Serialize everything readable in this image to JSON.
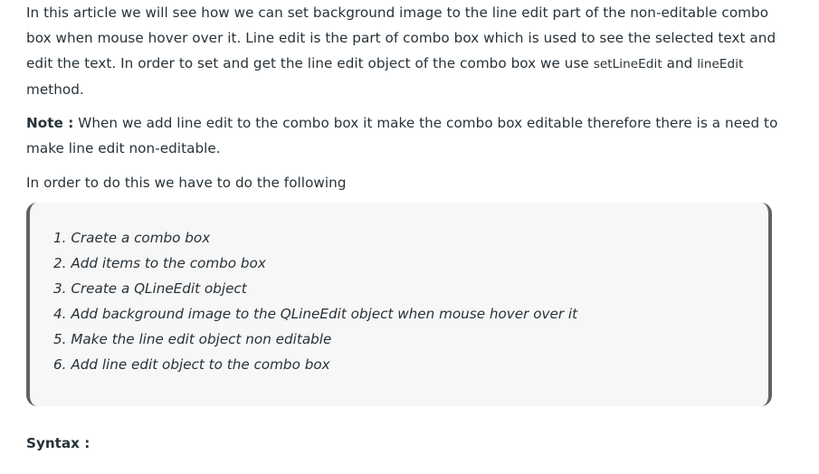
{
  "article": {
    "intro": {
      "text_before_code": "In this article we will see how we can set background image to the line edit part of the non-editable combo box when mouse hover over it. Line edit is the part of combo box which is used to see the selected text and edit the text. In order to set and get the line edit object of the combo box we use ",
      "code1": "setLineEdit",
      "and_text": " and ",
      "code2": "lineEdit",
      "text_after_code": " method."
    },
    "note": {
      "label": "Note :",
      "text": " When we add line edit to the combo box it make the combo box editable therefore there is a need to make line edit non-editable."
    },
    "lead_in": "In order to do this we have to do the following",
    "steps": [
      "1. Craete a combo box",
      "2. Add items to the combo box",
      "3. Create a QLineEdit object",
      "4. Add background image to the QLineEdit object when mouse hover over it",
      "5. Make the line edit object non editable",
      "6. Add line edit object to the combo box"
    ],
    "syntax_label": "Syntax :"
  }
}
